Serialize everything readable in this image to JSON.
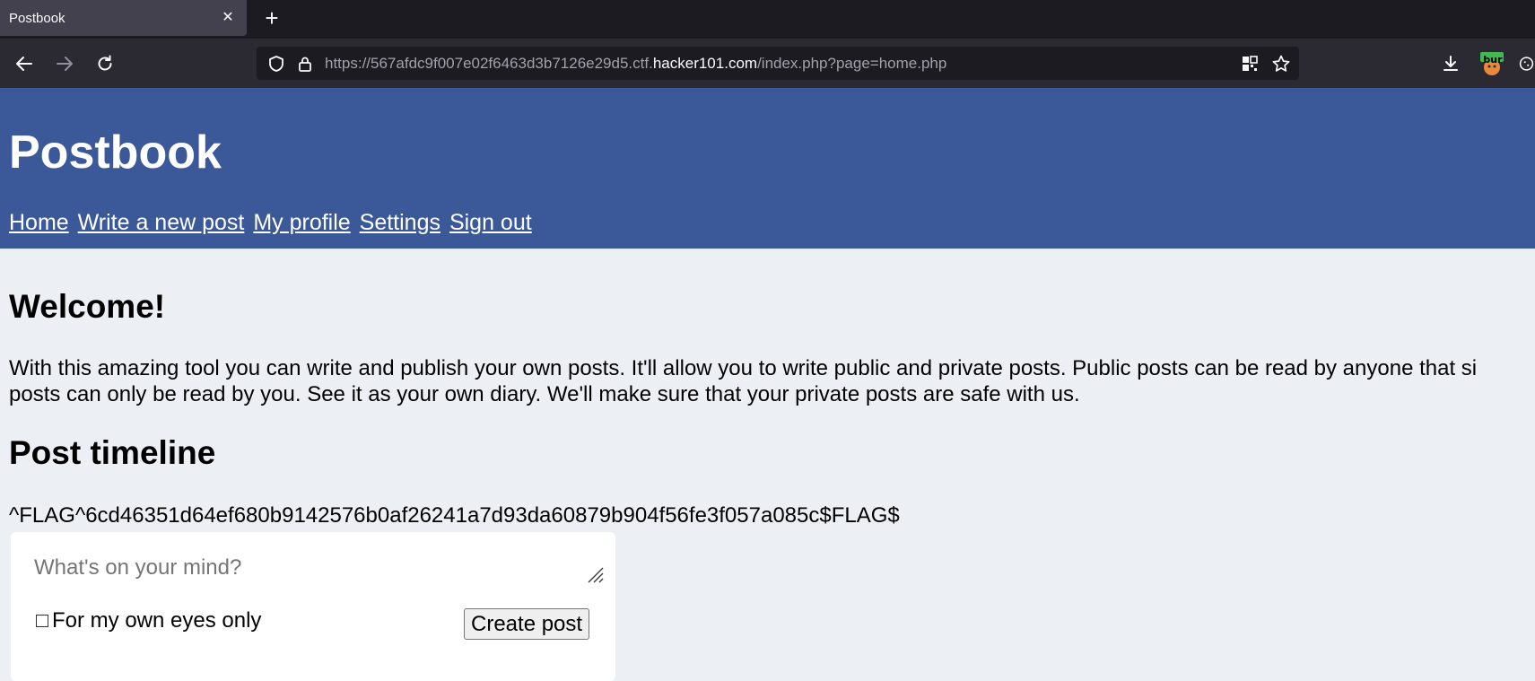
{
  "browser": {
    "tab": {
      "title": "Postbook"
    },
    "url": {
      "prefix": "https://567afdc9f007e02f6463d3b7126e29d5.ctf.",
      "host": "hacker101.com",
      "path": "/index.php?page=home.php"
    },
    "extension_badge": "bur"
  },
  "site": {
    "title": "Postbook",
    "nav": [
      "Home",
      "Write a new post",
      "My profile",
      "Settings",
      "Sign out"
    ]
  },
  "welcome": {
    "heading": "Welcome!",
    "line1": "With this amazing tool you can write and publish your own posts. It'll allow you to write public and private posts. Public posts can be read by anyone that si",
    "line2": "posts can only be read by you. See it as your own diary. We'll make sure that your private posts are safe with us."
  },
  "timeline": {
    "heading": "Post timeline",
    "flag_text": "^FLAG^6cd46351d64ef680b9142576b0af26241a7d93da60879b904f56fe3f057a085c$FLAG$"
  },
  "post_form": {
    "placeholder": "What's on your mind?",
    "private_label": "For my own eyes only",
    "submit_label": "Create post"
  },
  "colors": {
    "header_bg": "#3b5998",
    "page_bg": "#ecf0f5"
  }
}
